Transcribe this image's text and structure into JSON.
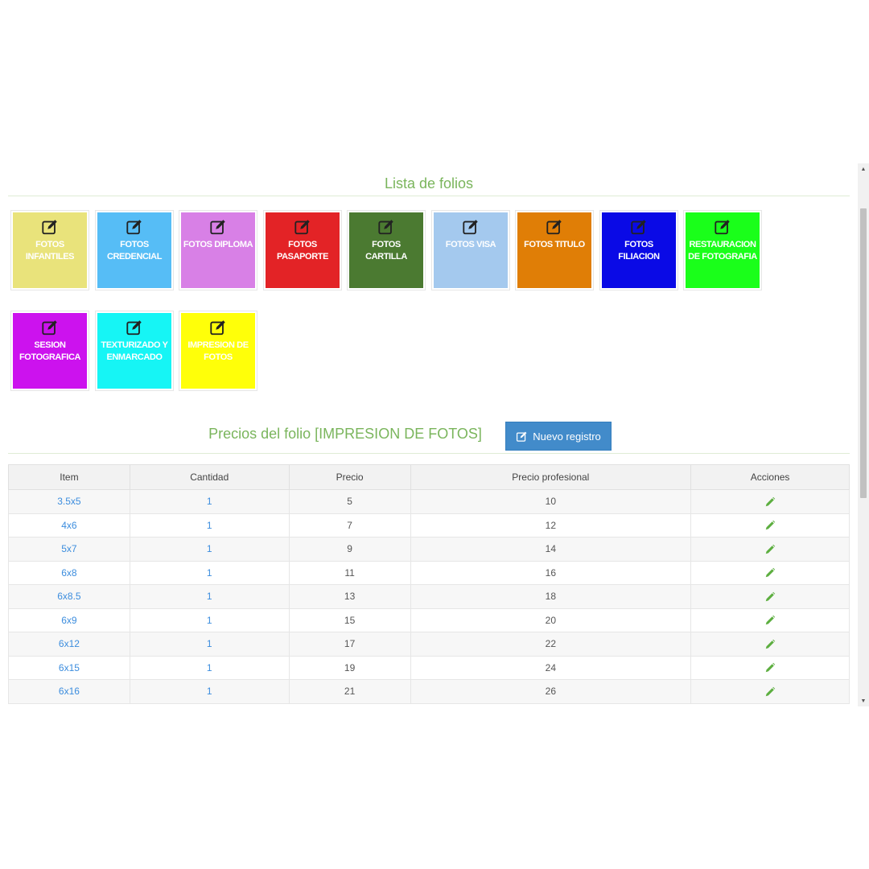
{
  "folios": {
    "title": "Lista de folios",
    "tiles": [
      {
        "label": "FOTOS INFANTILES",
        "color": "#e9e37b",
        "text_color": "#ffffff"
      },
      {
        "label": "FOTOS CREDENCIAL",
        "color": "#56bdf6",
        "text_color": "#ffffff"
      },
      {
        "label": "FOTOS DIPLOMA",
        "color": "#d880e6",
        "text_color": "#ffffff"
      },
      {
        "label": "FOTOS PASAPORTE",
        "color": "#e32326",
        "text_color": "#ffffff"
      },
      {
        "label": "FOTOS CARTILLA",
        "color": "#4b7a31",
        "text_color": "#ffffff"
      },
      {
        "label": "FOTOS VISA",
        "color": "#a4c9ee",
        "text_color": "#ffffff"
      },
      {
        "label": "FOTOS TITULO",
        "color": "#e07e06",
        "text_color": "#ffffff"
      },
      {
        "label": "FOTOS FILIACION",
        "color": "#0a0ae6",
        "text_color": "#ffffff"
      },
      {
        "label": "RESTAURACION DE FOTOGRAFIA",
        "color": "#1aff1a",
        "text_color": "#ffffff"
      },
      {
        "label": "SESION FOTOGRAFICA",
        "color": "#cc12ee",
        "text_color": "#ffffff"
      },
      {
        "label": "TEXTURIZADO Y ENMARCADO",
        "color": "#16f5f5",
        "text_color": "#ffffff"
      },
      {
        "label": "IMPRESION DE FOTOS",
        "color": "#ffff09",
        "text_color": "#ffffff"
      }
    ]
  },
  "prices": {
    "title": "Precios del folio [IMPRESION DE FOTOS]",
    "new_button_label": "Nuevo registro",
    "accent_color": "#7ab55c",
    "columns": [
      "Item",
      "Cantidad",
      "Precio",
      "Precio profesional",
      "Acciones"
    ],
    "rows": [
      {
        "item": "3.5x5",
        "cantidad": "1",
        "precio": "5",
        "precio_profesional": "10"
      },
      {
        "item": "4x6",
        "cantidad": "1",
        "precio": "7",
        "precio_profesional": "12"
      },
      {
        "item": "5x7",
        "cantidad": "1",
        "precio": "9",
        "precio_profesional": "14"
      },
      {
        "item": "6x8",
        "cantidad": "1",
        "precio": "11",
        "precio_profesional": "16"
      },
      {
        "item": "6x8.5",
        "cantidad": "1",
        "precio": "13",
        "precio_profesional": "18"
      },
      {
        "item": "6x9",
        "cantidad": "1",
        "precio": "15",
        "precio_profesional": "20"
      },
      {
        "item": "6x12",
        "cantidad": "1",
        "precio": "17",
        "precio_profesional": "22"
      },
      {
        "item": "6x15",
        "cantidad": "1",
        "precio": "19",
        "precio_profesional": "24"
      },
      {
        "item": "6x16",
        "cantidad": "1",
        "precio": "21",
        "precio_profesional": "26"
      }
    ],
    "action_icon": "pencil-icon"
  }
}
